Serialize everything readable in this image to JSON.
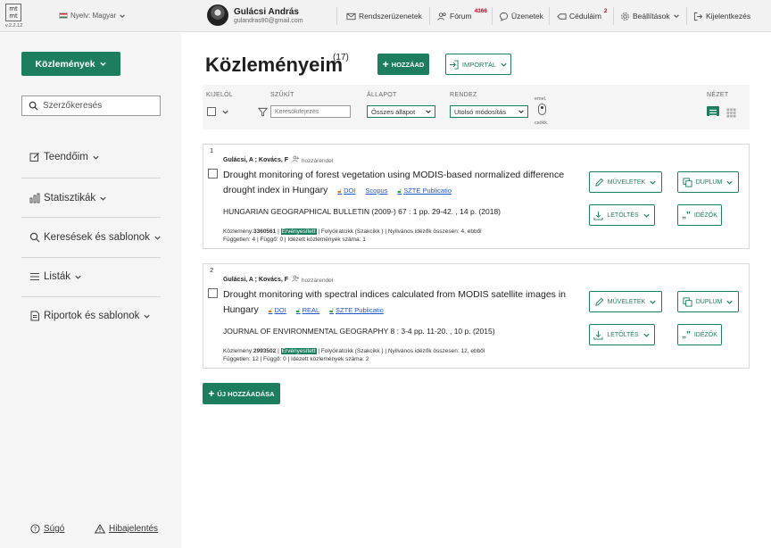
{
  "topbar": {
    "logo": "mt mt",
    "version": "v.2.2.12",
    "language": "Nyelv: Magyar",
    "user_name": "Gulácsi András",
    "user_email": "gulandras90@gmail.com",
    "nav": {
      "messages": "Rendszerüzenetek",
      "forum": "Fórum",
      "forum_count": "4366",
      "chat": "Üzenetek",
      "notes": "Céduláim",
      "notes_count": "2",
      "settings": "Beállítások",
      "logout": "Kijelentkezés"
    }
  },
  "sidebar": {
    "publications_button": "Közlemények",
    "author_search_placeholder": "Szerzőkeresés",
    "menu": {
      "todos": "Teendőim",
      "stats": "Statisztikák",
      "searches": "Keresések és sablonok",
      "lists": "Listák",
      "reports": "Riportok és sablonok"
    },
    "help": "Súgó",
    "bug_report": "Hibajelentés"
  },
  "main": {
    "title": "Közleményeim",
    "count": "(17)",
    "add_button": "HOZZÁAD",
    "import_button": "IMPORTÁL",
    "new_add_button": "ÚJ HOZZÁADÁSA"
  },
  "filters": {
    "select_label": "KIJELÖL",
    "narrow_label": "SZŰKÍT",
    "narrow_placeholder": "Keresőkifejezés",
    "status_label": "ÁLLAPOT",
    "status_value": "Összes állapot",
    "sort_label": "RENDEZ",
    "sort_value": "Utolsó módosítás",
    "asc": "emel.",
    "desc": "csökk.",
    "view_label": "NÉZET"
  },
  "publications": [
    {
      "num": "1",
      "authors": "Gulácsi, A ; Kovács, F",
      "assign": "hozzárendel",
      "title": "Drought monitoring of forest vegetation using MODIS-based normalized difference drought index in Hungary",
      "links": [
        "DOI",
        "Scopus",
        "SZTE Publicatio"
      ],
      "journal": "HUNGARIAN GEOGRAPHICAL BULLETIN (2009-) 67 : 1 pp. 29-42. , 14 p. (2018)",
      "id_label": "Közlemény:",
      "id": "3360561",
      "status": "Érvényesített",
      "type": "| Folyóiratcikk (Szakcikk ) | Nyilvános idézők összesen: 4, ebből",
      "cites": "Független: 4 | Függő: 0 | Idézett közlemények száma: 1"
    },
    {
      "num": "2",
      "authors": "Gulácsi, A ; Kovács, F",
      "assign": "hozzárendel",
      "title": "Drought monitoring with spectral indices calculated from MODIS satellite images in Hungary",
      "links": [
        "DOI",
        "REAL",
        "SZTE Publicatio"
      ],
      "journal": "JOURNAL OF ENVIRONMENTAL GEOGRAPHY 8 : 3-4 pp. 11-20. , 10 p. (2015)",
      "id_label": "Közlemény:",
      "id": "2993502",
      "status": "Érvényesített",
      "type": "| Folyóiratcikk (Szakcikk ) | Nyilvános idézők összesen: 12, ebből",
      "cites": "Független: 12 | Függő: 0 | Idézett közlemények száma: 2"
    }
  ],
  "card_buttons": {
    "operations": "MŰVELETEK",
    "duplicate": "DUPLUM",
    "download": "LETÖLTÉS",
    "citations": "IDÉZŐK"
  }
}
